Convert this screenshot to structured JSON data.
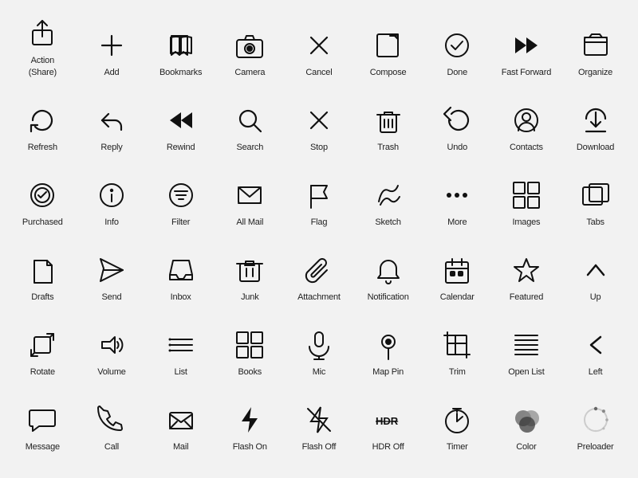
{
  "rows": [
    [
      {
        "name": "action-share",
        "label": "Action\n(Share)"
      },
      {
        "name": "add",
        "label": "Add"
      },
      {
        "name": "bookmarks",
        "label": "Bookmarks"
      },
      {
        "name": "camera",
        "label": "Camera"
      },
      {
        "name": "cancel",
        "label": "Cancel"
      },
      {
        "name": "compose",
        "label": "Compose"
      },
      {
        "name": "done",
        "label": "Done"
      },
      {
        "name": "fast-forward",
        "label": "Fast Forward"
      },
      {
        "name": "organize",
        "label": "Organize"
      }
    ],
    [
      {
        "name": "refresh",
        "label": "Refresh"
      },
      {
        "name": "reply",
        "label": "Reply"
      },
      {
        "name": "rewind",
        "label": "Rewind"
      },
      {
        "name": "search",
        "label": "Search"
      },
      {
        "name": "stop",
        "label": "Stop"
      },
      {
        "name": "trash",
        "label": "Trash"
      },
      {
        "name": "undo",
        "label": "Undo"
      },
      {
        "name": "contacts",
        "label": "Contacts"
      },
      {
        "name": "download",
        "label": "Download"
      }
    ],
    [
      {
        "name": "purchased",
        "label": "Purchased"
      },
      {
        "name": "info",
        "label": "Info"
      },
      {
        "name": "filter",
        "label": "Filter"
      },
      {
        "name": "all-mail",
        "label": "All Mail"
      },
      {
        "name": "flag",
        "label": "Flag"
      },
      {
        "name": "sketch",
        "label": "Sketch"
      },
      {
        "name": "more",
        "label": "More"
      },
      {
        "name": "images",
        "label": "Images"
      },
      {
        "name": "tabs",
        "label": "Tabs"
      }
    ],
    [
      {
        "name": "drafts",
        "label": "Drafts"
      },
      {
        "name": "send",
        "label": "Send"
      },
      {
        "name": "inbox",
        "label": "Inbox"
      },
      {
        "name": "junk",
        "label": "Junk"
      },
      {
        "name": "attachment",
        "label": "Attachment"
      },
      {
        "name": "notification",
        "label": "Notification"
      },
      {
        "name": "calendar",
        "label": "Calendar"
      },
      {
        "name": "featured",
        "label": "Featured"
      },
      {
        "name": "up",
        "label": "Up"
      }
    ],
    [
      {
        "name": "rotate",
        "label": "Rotate"
      },
      {
        "name": "volume",
        "label": "Volume"
      },
      {
        "name": "list",
        "label": "List"
      },
      {
        "name": "books",
        "label": "Books"
      },
      {
        "name": "mic",
        "label": "Mic"
      },
      {
        "name": "map-pin",
        "label": "Map Pin"
      },
      {
        "name": "trim",
        "label": "Trim"
      },
      {
        "name": "open-list",
        "label": "Open List"
      },
      {
        "name": "left",
        "label": "Left"
      }
    ],
    [
      {
        "name": "message",
        "label": "Message"
      },
      {
        "name": "call",
        "label": "Call"
      },
      {
        "name": "mail",
        "label": "Mail"
      },
      {
        "name": "flash-on",
        "label": "Flash On"
      },
      {
        "name": "flash-off",
        "label": "Flash Off"
      },
      {
        "name": "hdr-off",
        "label": "HDR Off"
      },
      {
        "name": "timer",
        "label": "Timer"
      },
      {
        "name": "color",
        "label": "Color"
      },
      {
        "name": "preloader",
        "label": "Preloader"
      }
    ]
  ]
}
